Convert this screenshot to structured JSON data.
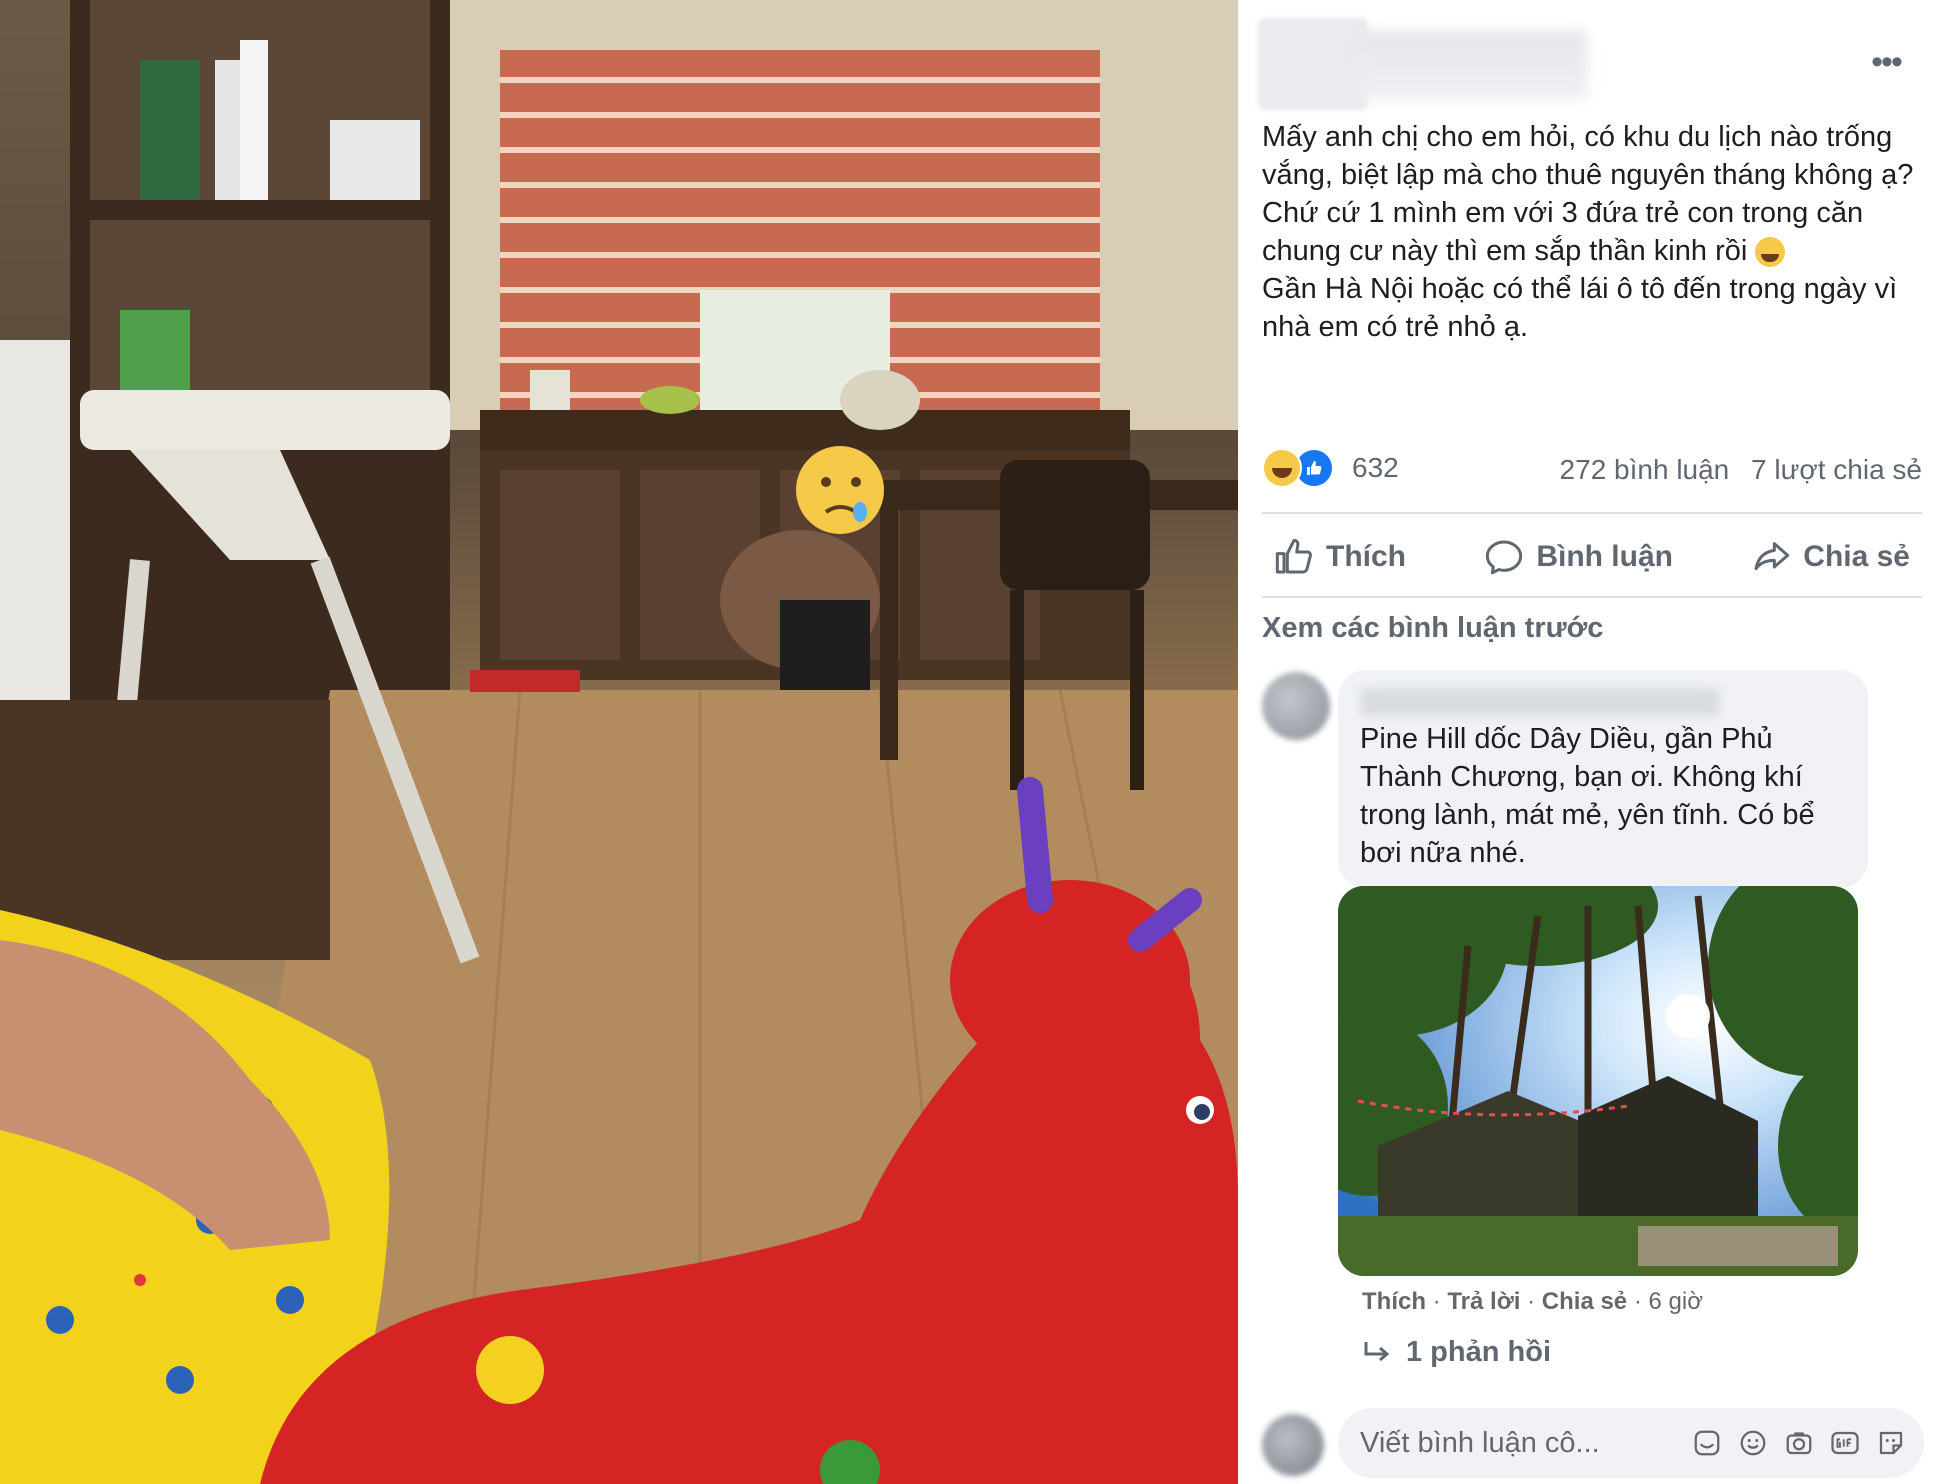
{
  "post": {
    "paragraph_1": "Mấy anh chị cho em hỏi, có khu du lịch nào trống vắng, biệt lập mà cho thuê nguyên tháng không ạ? Chứ cứ 1 mình em với 3 đứa trẻ con trong căn chung cư này thì em sắp thần kinh rồi",
    "paragraph_2": "Gần Hà Nội hoặc có thể lái ô tô đến trong ngày vì nhà em có trẻ nhỏ ạ.",
    "emoji_icon": "crying-emoji-icon",
    "more_icon": "•••"
  },
  "stats": {
    "reaction_count": "632",
    "comments": "272 bình luận",
    "shares": "7 lượt chia sẻ",
    "reaction_icons": [
      "haha-reaction-icon",
      "like-reaction-icon"
    ]
  },
  "actions": {
    "like": "Thích",
    "comment": "Bình luận",
    "share": "Chia sẻ"
  },
  "comments": {
    "view_previous": "Xem các bình luận trước",
    "items": [
      {
        "text": "Pine Hill dốc Dây Diều, gần Phủ Thành Chương, bạn ơi. Không khí trong lành, mát mẻ, yên tĩnh. Có bể bơi nữa nhé.",
        "like": "Thích",
        "reply": "Trả lời",
        "share": "Chia sẻ",
        "time": "6 giờ",
        "replies": "1 phản hồi"
      }
    ]
  },
  "composer": {
    "placeholder": "Viết bình luận cô...",
    "icons": [
      "sticker-icon",
      "emoji-icon",
      "camera-icon",
      "gif-icon",
      "avatar-sticker-icon"
    ]
  },
  "colors": {
    "accent": "#1877f2",
    "muted_text": "#606770",
    "bubble_bg": "#f0f2f5",
    "divider": "#dddfe2"
  }
}
